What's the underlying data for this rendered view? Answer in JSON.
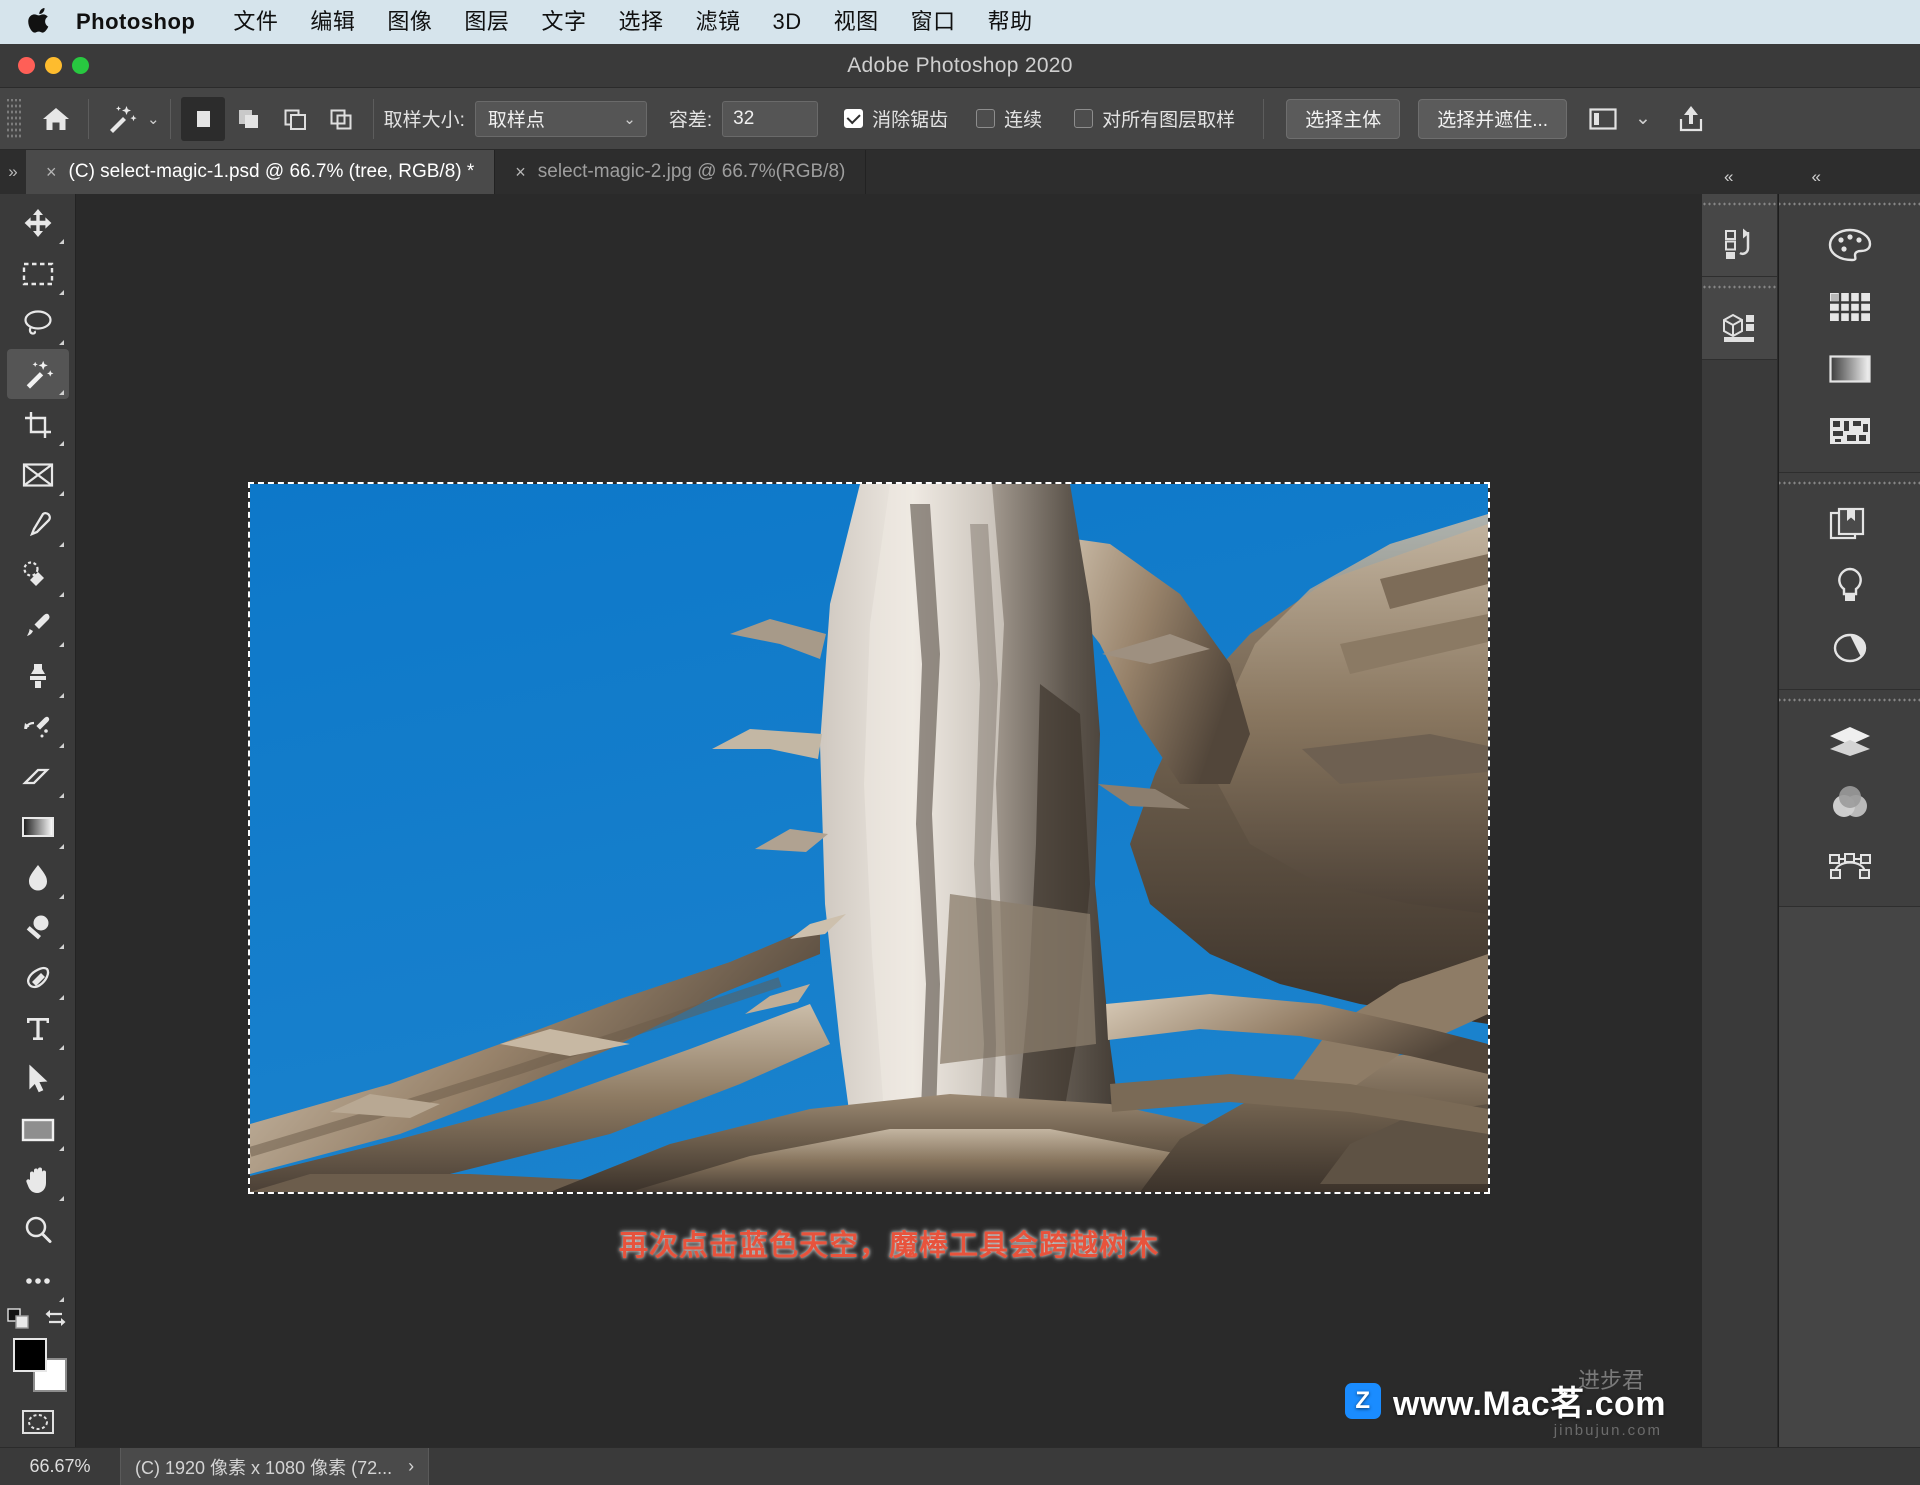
{
  "macmenu": {
    "apple_icon": "apple-logo-icon",
    "items": [
      {
        "label": "Photoshop",
        "bold": true
      },
      {
        "label": "文件"
      },
      {
        "label": "编辑"
      },
      {
        "label": "图像"
      },
      {
        "label": "图层"
      },
      {
        "label": "文字"
      },
      {
        "label": "选择"
      },
      {
        "label": "滤镜"
      },
      {
        "label": "3D"
      },
      {
        "label": "视图"
      },
      {
        "label": "窗口"
      },
      {
        "label": "帮助"
      }
    ]
  },
  "window": {
    "title": "Adobe Photoshop 2020"
  },
  "options": {
    "home_icon": "home-icon",
    "tool_icon": "magic-wand-icon",
    "tool_chevron": "chevron-down-icon",
    "selection_modes": [
      {
        "name": "new-selection",
        "active": true
      },
      {
        "name": "add-to-selection",
        "active": false
      },
      {
        "name": "subtract-from-selection",
        "active": false
      },
      {
        "name": "intersect-with-selection",
        "active": false
      }
    ],
    "sample_size_label": "取样大小:",
    "sample_size_value": "取样点",
    "tolerance_label": "容差:",
    "tolerance_value": "32",
    "antialias_label": "消除锯齿",
    "antialias_checked": true,
    "contiguous_label": "连续",
    "contiguous_checked": false,
    "sample_all_layers_label": "对所有图层取样",
    "sample_all_layers_checked": false,
    "select_subject_label": "选择主体",
    "select_and_mask_label": "选择并遮住...",
    "workspace_icon": "workspace-panel-icon",
    "workspace_chevron": "chevron-down-icon",
    "share_icon": "share-upload-icon"
  },
  "tabs": {
    "collapse_icon": "chevrons-right-icon",
    "items": [
      {
        "label": "(C) select-magic-1.psd @ 66.7% (tree, RGB/8) *",
        "active": true,
        "close_icon": "close-icon"
      },
      {
        "label": "select-magic-2.jpg @ 66.7%(RGB/8)",
        "active": false,
        "close_icon": "close-icon"
      }
    ]
  },
  "toolbar": {
    "tools": [
      {
        "name": "move-tool-icon",
        "active": false
      },
      {
        "name": "rectangular-marquee-tool-icon",
        "active": false
      },
      {
        "name": "lasso-tool-icon",
        "active": false
      },
      {
        "name": "magic-wand-tool-icon",
        "active": true
      },
      {
        "name": "crop-tool-icon",
        "active": false
      },
      {
        "name": "frame-tool-icon",
        "active": false
      },
      {
        "name": "eyedropper-tool-icon",
        "active": false
      },
      {
        "name": "spot-healing-brush-tool-icon",
        "active": false
      },
      {
        "name": "brush-tool-icon",
        "active": false
      },
      {
        "name": "clone-stamp-tool-icon",
        "active": false
      },
      {
        "name": "history-brush-tool-icon",
        "active": false
      },
      {
        "name": "eraser-tool-icon",
        "active": false
      },
      {
        "name": "gradient-tool-icon",
        "active": false
      },
      {
        "name": "blur-tool-icon",
        "active": false
      },
      {
        "name": "dodge-tool-icon",
        "active": false
      },
      {
        "name": "pen-tool-icon",
        "active": false
      },
      {
        "name": "type-tool-icon",
        "active": false
      },
      {
        "name": "path-selection-tool-icon",
        "active": false
      },
      {
        "name": "rectangle-tool-icon",
        "active": false
      },
      {
        "name": "hand-tool-icon",
        "active": false
      },
      {
        "name": "zoom-tool-icon",
        "active": false
      },
      {
        "name": "edit-toolbar-icon",
        "active": false
      }
    ],
    "swap_icon": "swap-colors-icon",
    "default_colors_icon": "default-colors-icon",
    "foreground_color": "#000000",
    "background_color": "#ffffff",
    "quickmask_icon": "quick-mask-icon"
  },
  "canvas": {
    "annotation": "再次点击蓝色天空，魔棒工具会跨越树木",
    "sky_color": "#1178c4",
    "background_color": "#2a2a2a",
    "selection_active": true
  },
  "rightpanels": {
    "collapse_left_icon": "chevrons-left-icon",
    "collapse_right_icon": "chevrons-left-icon",
    "columnA": [
      {
        "name": "history-panel-icon"
      },
      {
        "name": "3d-panel-icon"
      }
    ],
    "columnB_groups": [
      {
        "icons": [
          {
            "name": "color-swatches-panel-icon"
          },
          {
            "name": "swatches-grid-panel-icon"
          },
          {
            "name": "gradients-panel-icon"
          },
          {
            "name": "patterns-panel-icon"
          }
        ]
      },
      {
        "icons": [
          {
            "name": "libraries-panel-icon"
          },
          {
            "name": "adjustments-panel-icon"
          },
          {
            "name": "properties-panel-icon"
          }
        ]
      },
      {
        "icons": [
          {
            "name": "layers-panel-icon"
          },
          {
            "name": "channels-panel-icon"
          },
          {
            "name": "paths-panel-icon"
          }
        ]
      }
    ]
  },
  "statusbar": {
    "zoom": "66.67%",
    "doc_info": "(C) 1920 像素 x 1080 像素 (72...",
    "expand_icon": "chevron-right-icon"
  },
  "watermark": {
    "badge": "Z",
    "text": "www.Mac茗",
    "suffix": ".com",
    "sub": "jinbujun.com",
    "cn": "进步君"
  },
  "colors": {
    "menubar_bg": "#d6e4ec",
    "titlebar_bg": "#3a3a3a",
    "optionsbar_bg": "#454545",
    "panel_bg": "#3a3a3a",
    "canvas_bg": "#2a2a2a",
    "accent_red": "#e8533c",
    "sky_blue": "#1178c4"
  }
}
